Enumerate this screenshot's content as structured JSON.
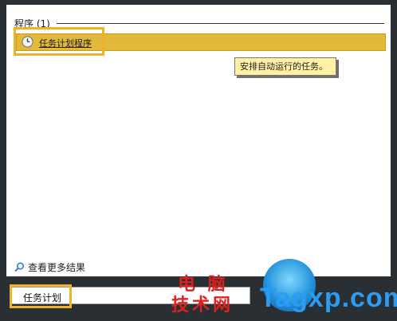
{
  "section": {
    "title": "程序 (1)"
  },
  "result": {
    "label": "任务计划程序",
    "icon": "clock-icon"
  },
  "tooltip": {
    "text": "安排自动运行的任务。"
  },
  "see_more": {
    "label": "查看更多结果",
    "icon": "search-icon"
  },
  "search": {
    "value": "任务计划"
  },
  "watermark": {
    "cn_line1": "电 脑",
    "cn_line2": "技术网",
    "en": "Tagxp.com"
  },
  "colors": {
    "highlight": "#e2b93b",
    "callout_border": "#f0b328",
    "tooltip_bg": "#fff0a6",
    "background": "#2a2f33"
  }
}
